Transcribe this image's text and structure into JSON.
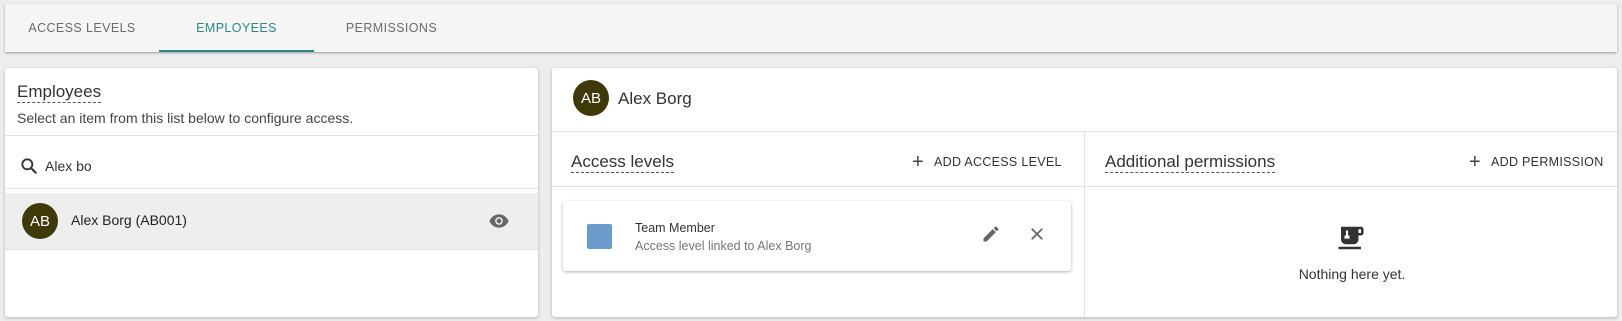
{
  "tabs": [
    {
      "label": "ACCESS LEVELS",
      "active": false
    },
    {
      "label": "EMPLOYEES",
      "active": true
    },
    {
      "label": "PERMISSIONS",
      "active": false
    }
  ],
  "colors": {
    "accent": "#2b8a86",
    "avatar_bg": "#3f3808",
    "swatch": "#6a9bcb"
  },
  "employees_panel": {
    "title": "Employees",
    "subtitle": "Select an item from this list below to configure access.",
    "search": {
      "value": "Alex bo",
      "icon": "search-icon"
    },
    "items": [
      {
        "initials": "AB",
        "name": "Alex Borg (AB001)",
        "action_icon": "eye-icon"
      }
    ]
  },
  "detail": {
    "avatar_initials": "AB",
    "name": "Alex Borg",
    "access_levels": {
      "title": "Access levels",
      "add_label": "ADD ACCESS LEVEL",
      "items": [
        {
          "title": "Team Member",
          "subtitle": "Access level linked to Alex Borg",
          "edit_icon": "pencil-icon",
          "remove_icon": "close-icon"
        }
      ]
    },
    "permissions": {
      "title": "Additional permissions",
      "add_label": "ADD PERMISSION",
      "empty_icon": "coffee-cup-icon",
      "empty_text": "Nothing here yet."
    }
  }
}
